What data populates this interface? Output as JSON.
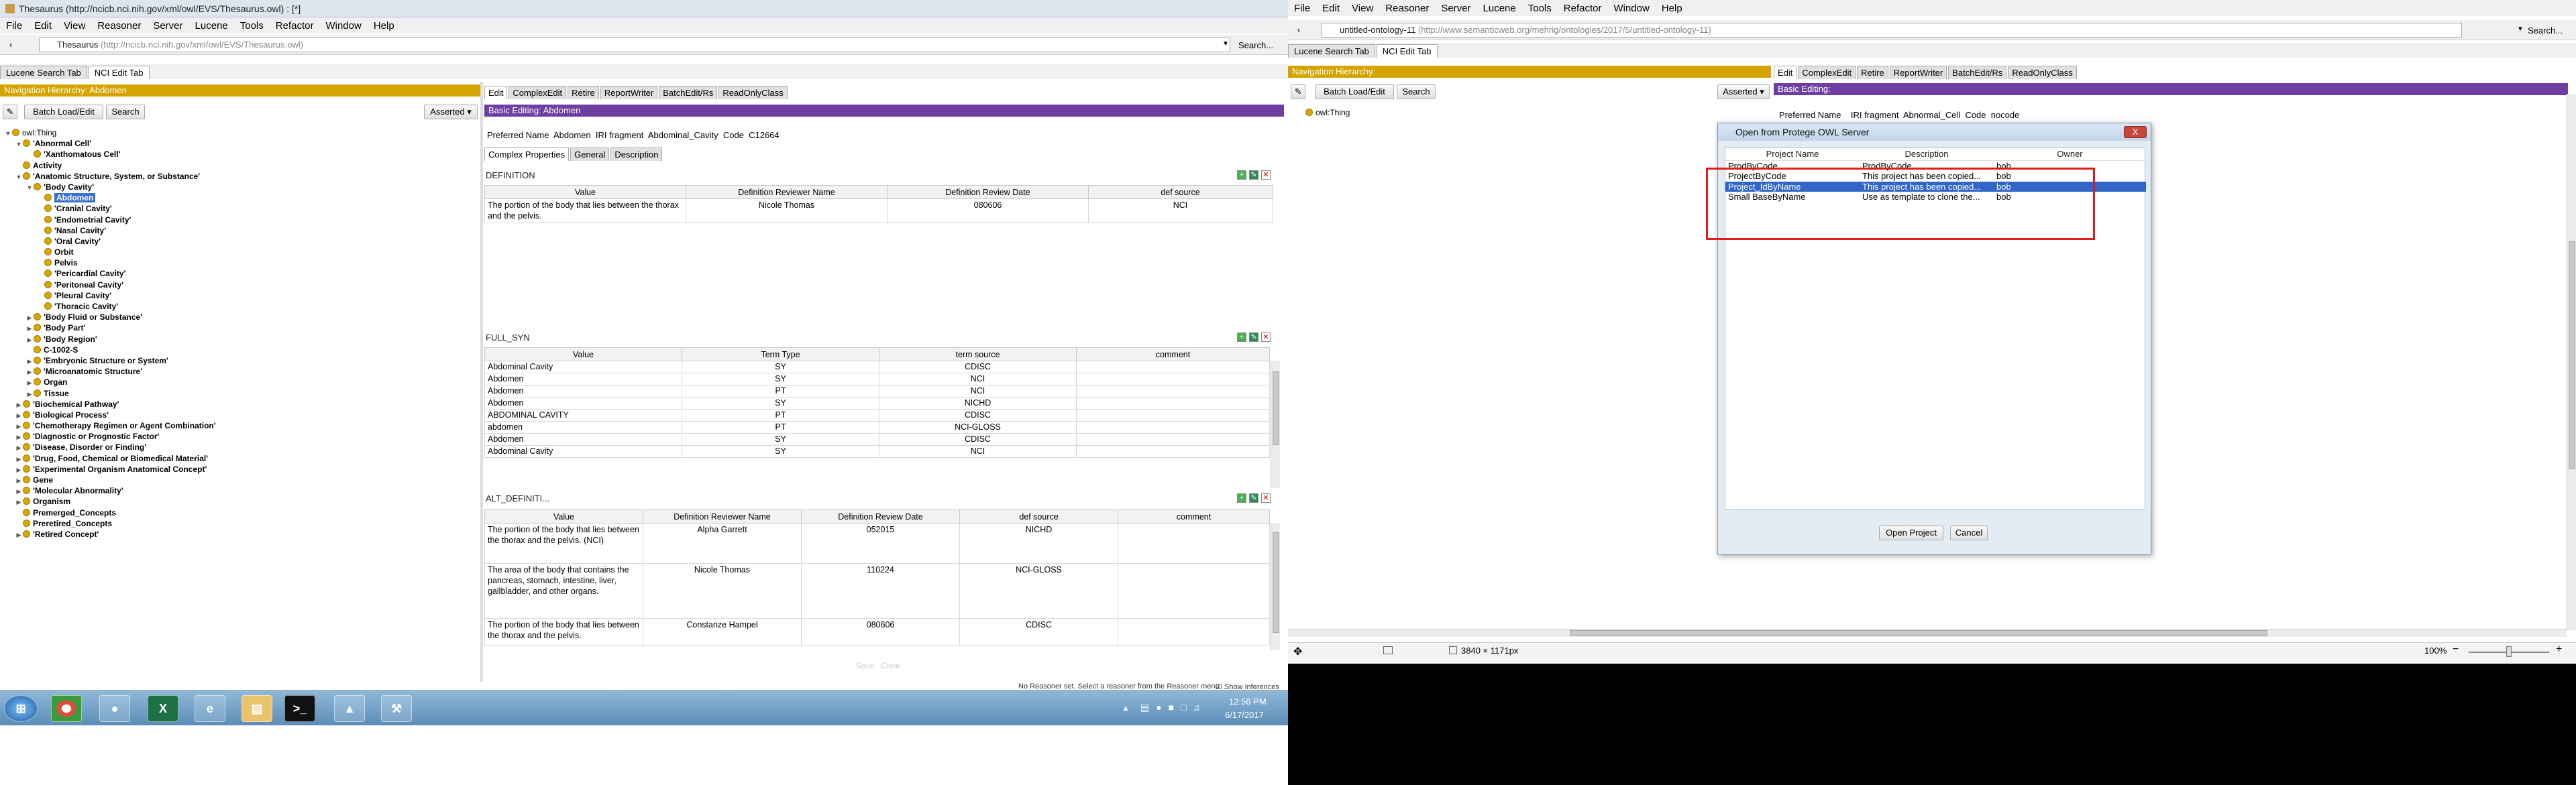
{
  "left_window": {
    "title": "Thesaurus (http://ncicb.nci.nih.gov/xml/owl/EVS/Thesaurus.owl) : [*]",
    "menu": [
      "File",
      "Edit",
      "View",
      "Reasoner",
      "Server",
      "Lucene",
      "Tools",
      "Refactor",
      "Window",
      "Help"
    ],
    "address_label": "Thesaurus",
    "address_url": "(http://ncicb.nci.nih.gov/xml/owl/EVS/Thesaurus.owl)",
    "search_label": "Search...",
    "tabs": [
      "Lucene Search Tab",
      "NCI Edit Tab"
    ],
    "nav_header": "Navigation Hierarchy: Abdomen",
    "batch_button": "Batch Load/Edit",
    "search_button": "Search",
    "asserted_label": "Asserted",
    "tree": [
      {
        "label": "owl:Thing",
        "indent": 0,
        "exp": "-",
        "bold": false
      },
      {
        "label": "'Abnormal Cell'",
        "indent": 1,
        "exp": "-",
        "bold": true
      },
      {
        "label": "'Xanthomatous Cell'",
        "indent": 2,
        "exp": "",
        "bold": true
      },
      {
        "label": "Activity",
        "indent": 1,
        "exp": "",
        "bold": true
      },
      {
        "label": "'Anatomic Structure, System, or Substance'",
        "indent": 1,
        "exp": "-",
        "bold": true
      },
      {
        "label": "'Body Cavity'",
        "indent": 2,
        "exp": "-",
        "bold": true
      },
      {
        "label": "Abdomen",
        "indent": 3,
        "exp": "",
        "bold": true,
        "selected": true
      },
      {
        "label": "'Cranial Cavity'",
        "indent": 3,
        "exp": "",
        "bold": true
      },
      {
        "label": "'Endometrial Cavity'",
        "indent": 3,
        "exp": "",
        "bold": true
      },
      {
        "label": "'Nasal Cavity'",
        "indent": 3,
        "exp": "",
        "bold": true
      },
      {
        "label": "'Oral Cavity'",
        "indent": 3,
        "exp": "",
        "bold": true
      },
      {
        "label": "Orbit",
        "indent": 3,
        "exp": "",
        "bold": true
      },
      {
        "label": "Pelvis",
        "indent": 3,
        "exp": "",
        "bold": true
      },
      {
        "label": "'Pericardial Cavity'",
        "indent": 3,
        "exp": "",
        "bold": true
      },
      {
        "label": "'Peritoneal Cavity'",
        "indent": 3,
        "exp": "",
        "bold": true
      },
      {
        "label": "'Pleural Cavity'",
        "indent": 3,
        "exp": "",
        "bold": true
      },
      {
        "label": "'Thoracic Cavity'",
        "indent": 3,
        "exp": "",
        "bold": true
      },
      {
        "label": "'Body Fluid or Substance'",
        "indent": 2,
        "exp": "+",
        "bold": true
      },
      {
        "label": "'Body Part'",
        "indent": 2,
        "exp": "+",
        "bold": true
      },
      {
        "label": "'Body Region'",
        "indent": 2,
        "exp": "+",
        "bold": true
      },
      {
        "label": "C-1002-S",
        "indent": 2,
        "exp": "",
        "bold": true
      },
      {
        "label": "'Embryonic Structure or System'",
        "indent": 2,
        "exp": "+",
        "bold": true
      },
      {
        "label": "'Microanatomic Structure'",
        "indent": 2,
        "exp": "+",
        "bold": true
      },
      {
        "label": "Organ",
        "indent": 2,
        "exp": "+",
        "bold": true
      },
      {
        "label": "Tissue",
        "indent": 2,
        "exp": "+",
        "bold": true
      },
      {
        "label": "'Biochemical Pathway'",
        "indent": 1,
        "exp": "+",
        "bold": true
      },
      {
        "label": "'Biological Process'",
        "indent": 1,
        "exp": "+",
        "bold": true
      },
      {
        "label": "'Chemotherapy Regimen or Agent Combination'",
        "indent": 1,
        "exp": "+",
        "bold": true
      },
      {
        "label": "'Diagnostic or Prognostic Factor'",
        "indent": 1,
        "exp": "+",
        "bold": true
      },
      {
        "label": "'Disease, Disorder or Finding'",
        "indent": 1,
        "exp": "+",
        "bold": true
      },
      {
        "label": "'Drug, Food, Chemical or Biomedical Material'",
        "indent": 1,
        "exp": "+",
        "bold": true
      },
      {
        "label": "'Experimental Organism Anatomical Concept'",
        "indent": 1,
        "exp": "+",
        "bold": true
      },
      {
        "label": "Gene",
        "indent": 1,
        "exp": "+",
        "bold": true
      },
      {
        "label": "'Molecular Abnormality'",
        "indent": 1,
        "exp": "+",
        "bold": true
      },
      {
        "label": "Organism",
        "indent": 1,
        "exp": "+",
        "bold": true
      },
      {
        "label": "Premerged_Concepts",
        "indent": 1,
        "exp": "",
        "bold": true
      },
      {
        "label": "Preretired_Concepts",
        "indent": 1,
        "exp": "",
        "bold": true
      },
      {
        "label": "'Retired Concept'",
        "indent": 1,
        "exp": "+",
        "bold": true
      }
    ],
    "edit_tabs": [
      "Edit",
      "ComplexEdit",
      "Retire",
      "ReportWriter",
      "BatchEdit/Rs",
      "ReadOnlyClass"
    ],
    "basic_editing_header": "Basic Editing: Abdomen",
    "preferred_name_line": "Preferred Name  Abdomen  IRI fragment  Abdominal_Cavity  Code  C12664",
    "sub_tabs": [
      "Complex Properties",
      "General",
      "Description"
    ],
    "definition": {
      "title": "DEFINITION",
      "headers": [
        "Value",
        "Definition Reviewer Name",
        "Definition Review Date",
        "def source"
      ],
      "rows": [
        [
          "The portion of the body that lies between the thorax and the pelvis.",
          "Nicole Thomas",
          "080606",
          "NCI"
        ]
      ]
    },
    "full_syn": {
      "title": "FULL_SYN",
      "headers": [
        "Value",
        "Term Type",
        "term source",
        "comment"
      ],
      "rows": [
        [
          "Abdominal Cavity",
          "SY",
          "CDISC",
          ""
        ],
        [
          "Abdomen",
          "SY",
          "NCI",
          ""
        ],
        [
          "Abdomen",
          "PT",
          "NCI",
          ""
        ],
        [
          "Abdomen",
          "SY",
          "NICHD",
          ""
        ],
        [
          "ABDOMINAL CAVITY",
          "PT",
          "CDISC",
          ""
        ],
        [
          "abdomen",
          "PT",
          "NCI-GLOSS",
          ""
        ],
        [
          "Abdomen",
          "SY",
          "CDISC",
          ""
        ],
        [
          "Abdominal Cavity",
          "SY",
          "NCI",
          ""
        ]
      ]
    },
    "alt_def": {
      "title": "ALT_DEFINITI...",
      "headers": [
        "Value",
        "Definition Reviewer Name",
        "Definition Review Date",
        "def source",
        "comment"
      ],
      "rows": [
        [
          "The portion of the body that lies between the thorax and the pelvis. (NCI)",
          "Alpha Garrett",
          "052015",
          "NICHD",
          ""
        ],
        [
          "The area of the body that contains the pancreas, stomach, intestine, liver, gallbladder, and other organs.",
          "Nicole Thomas",
          "110224",
          "NCI-GLOSS",
          ""
        ],
        [
          "The portion of the body that lies between the thorax and the pelvis.",
          "Constanze Hampel",
          "080606",
          "CDISC",
          ""
        ]
      ]
    },
    "faded_buttons": "Save   Clear",
    "status_text": "No Reasoner set. Select a reasoner from the Reasoner menu",
    "show_inferences": "Show Inferences",
    "clock_time": "12:56 PM",
    "clock_date": "6/17/2017"
  },
  "right_window": {
    "menu": [
      "File",
      "Edit",
      "View",
      "Reasoner",
      "Server",
      "Lucene",
      "Tools",
      "Refactor",
      "Window",
      "Help"
    ],
    "address_label": "untitled-ontology-11",
    "address_url": "(http://www.semanticweb.org/mehrig/ontologies/2017/5/untitled-ontology-11)",
    "search_label": "Search...",
    "tabs": [
      "Lucene Search Tab",
      "NCI Edit Tab"
    ],
    "nav_header": "Navigation Hierarchy:",
    "batch_button": "Batch Load/Edit",
    "search_button": "Search",
    "asserted_label": "Asserted",
    "tree_root": "owl:Thing",
    "edit_tabs": [
      "Edit",
      "ComplexEdit",
      "Retire",
      "ReportWriter",
      "BatchEdit/Rs",
      "ReadOnlyClass"
    ],
    "basic_editing_header": "Basic Editing:",
    "preferred_name_line": "Preferred Name    IRI fragment  Abnormal_Cell  Code  nocode",
    "status_dims": "3840 × 1171px",
    "zoom": "100%"
  },
  "dialog": {
    "title": "Open from Protege OWL Server",
    "close": "X",
    "headers": [
      "Project Name",
      "Description",
      "Owner"
    ],
    "rows": [
      [
        "ProdByCode",
        "ProdByCode",
        "bob"
      ],
      [
        "ProjectByCode",
        "This project has been copied...",
        "bob"
      ],
      [
        "Project_IdByName",
        "This project has been copied...",
        "bob"
      ],
      [
        "Small BaseByName",
        "Use as template to clone the...",
        "bob"
      ]
    ],
    "selected_row": 2,
    "open_button": "Open Project",
    "cancel_button": "Cancel"
  },
  "colors": {
    "nav_header": "#d5a400",
    "edit_header": "#6f3ea1",
    "selection": "#3166c8",
    "highlight_box": "#e01b1b"
  }
}
